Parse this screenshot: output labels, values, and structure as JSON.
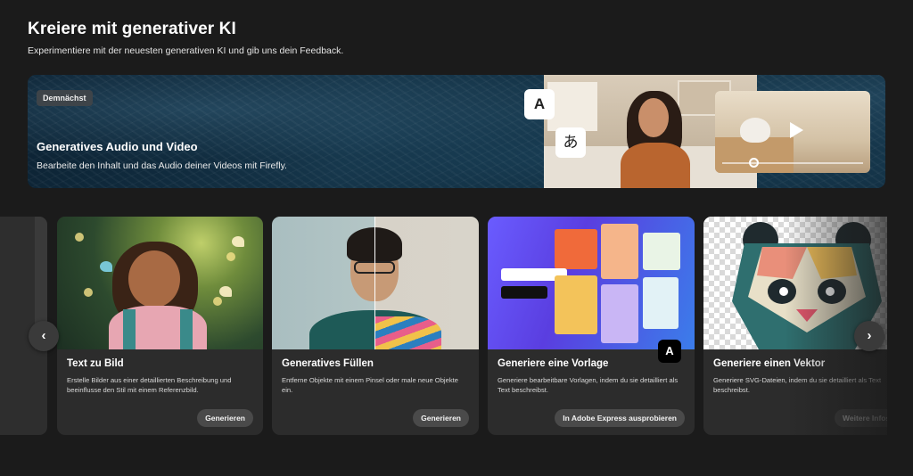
{
  "header": {
    "title": "Kreiere mit generativer KI",
    "subtitle": "Experimentiere mit der neuesten generativen KI und gib uns dein Feedback."
  },
  "banner": {
    "badge": "Demnächst",
    "title": "Generatives Audio und Video",
    "description": "Bearbeite den Inhalt und das Audio deiner Videos mit Firefly.",
    "lang_a": "A",
    "lang_ja": "あ"
  },
  "cards": [
    {
      "title": "Text zu Bild",
      "description": "Erstelle Bilder aus einer detaillierten Beschreibung und beeinflusse den Stil mit einem Referenzbild.",
      "button": "Generieren"
    },
    {
      "title": "Generatives Füllen",
      "description": "Entferne Objekte mit einem Pinsel oder male neue Objekte ein.",
      "button": "Generieren"
    },
    {
      "title": "Generiere eine Vorlage",
      "description": "Generiere bearbeitbare Vorlagen, indem du sie detailliert als Text beschreibst.",
      "button": "In Adobe Express ausprobieren"
    },
    {
      "title": "Generiere einen Vektor",
      "description": "Generiere SVG-Dateien, indem du sie detailliert als Text beschreibst.",
      "button": "Weitere Infos"
    }
  ],
  "carousel": {
    "prev_icon": "chevron-left-icon",
    "next_icon": "chevron-right-icon",
    "prev_glyph": "‹",
    "next_glyph": "›"
  },
  "colors": {
    "background": "#1b1b1b",
    "card": "#2c2c2c",
    "button": "#4a4a4a",
    "badge": "#3e4449"
  }
}
